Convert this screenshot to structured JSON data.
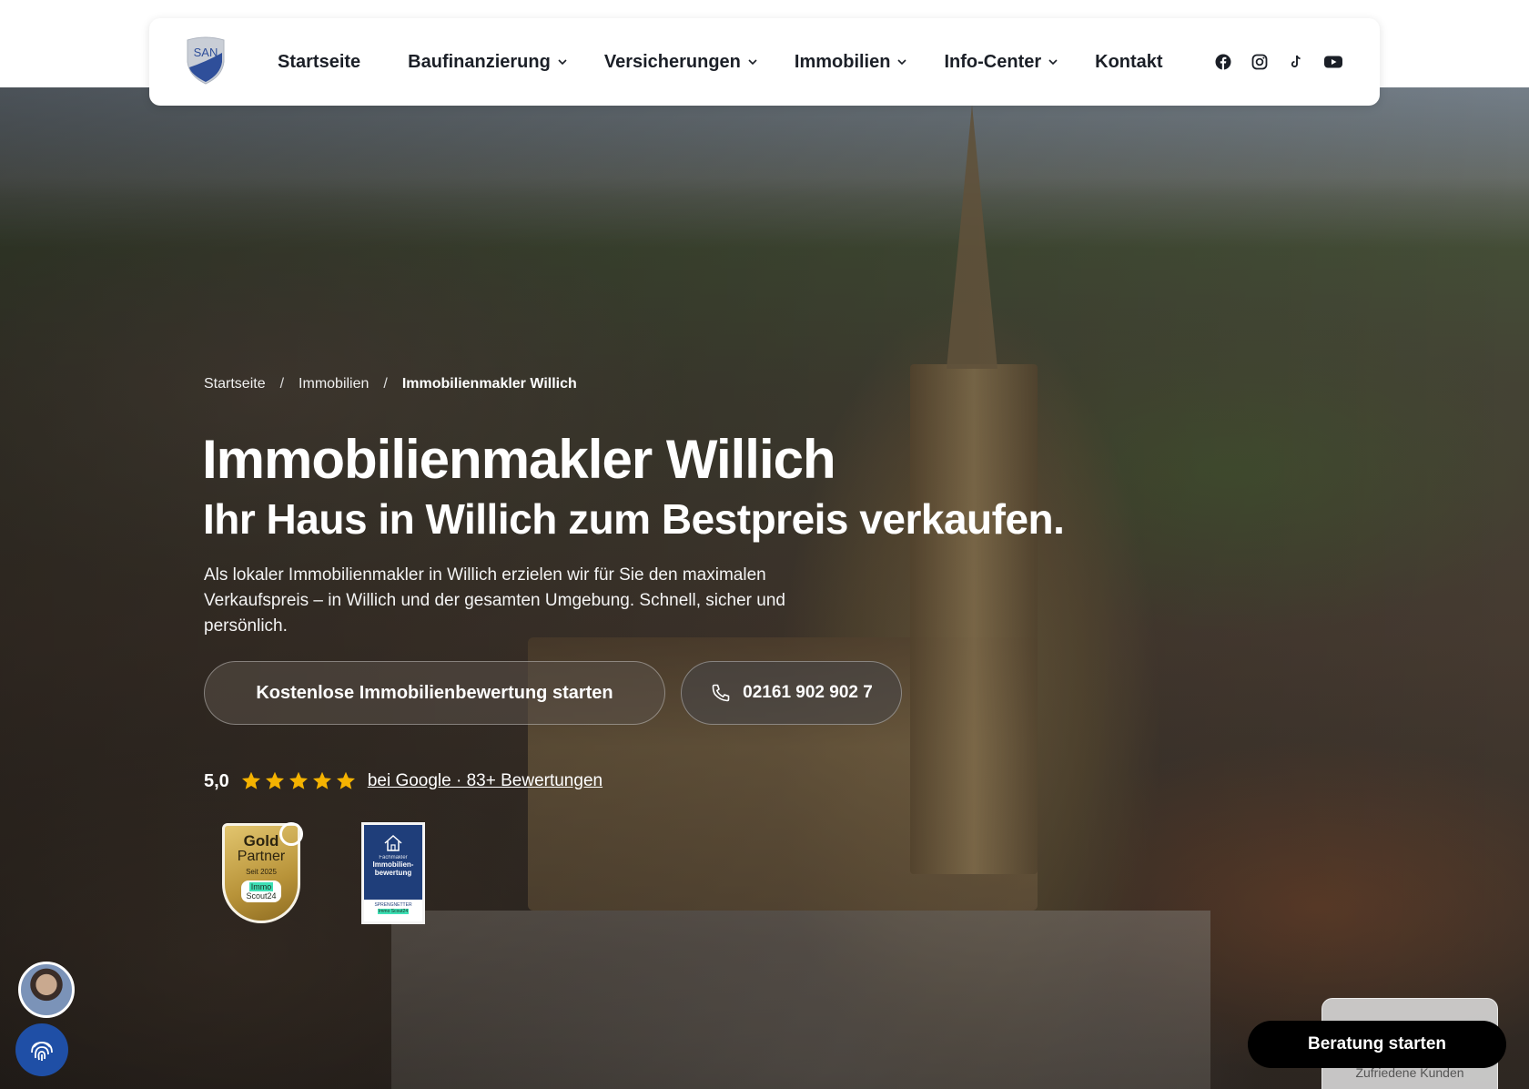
{
  "nav": {
    "logo_text": "SAN",
    "items": [
      {
        "label": "Startseite",
        "has_dropdown": false
      },
      {
        "label": "Baufinanzierung",
        "has_dropdown": true
      },
      {
        "label": "Versicherungen",
        "has_dropdown": true
      },
      {
        "label": "Immobilien",
        "has_dropdown": true
      },
      {
        "label": "Info-Center",
        "has_dropdown": true
      },
      {
        "label": "Kontakt",
        "has_dropdown": false
      }
    ],
    "socials": [
      "facebook-icon",
      "instagram-icon",
      "tiktok-icon",
      "youtube-icon"
    ]
  },
  "breadcrumb": {
    "items": [
      "Startseite",
      "Immobilien",
      "Immobilienmakler Willich"
    ],
    "separator": "/"
  },
  "hero": {
    "title": "Immobilienmakler Willich",
    "subtitle": "Ihr Haus in Willich zum Bestpreis verkaufen.",
    "intro": "Als lokaler Immobilienmakler in Willich erzielen wir für Sie den maximalen Verkaufspreis – in Willich und der gesamten Umgebung. Schnell, sicher und persönlich.",
    "cta_primary": "Kostenlose Immobilienbewertung starten",
    "cta_phone": "02161 902 902 7"
  },
  "rating": {
    "score": "5,0",
    "stars": 5,
    "link_text": "bei Google · 83+ Bewertungen",
    "star_color": "#F5B301"
  },
  "badges": {
    "gold": {
      "line1": "Gold",
      "line2": "Partner",
      "since": "Seit 2025",
      "brand_top": "Immo",
      "brand_bottom": "Scout24"
    },
    "blue": {
      "kicker": "Fachmakler",
      "title": "Immobilien-bewertung",
      "brand_line": "SPRENGNETTER",
      "brand": "Immo Scout24"
    }
  },
  "widgets": {
    "consult_button": "Beratung starten",
    "review_card_text": "Zufriedene Kunden"
  },
  "colors": {
    "nav_text": "#1B1F27",
    "consult_bg": "#000000",
    "fingerprint_bg": "#1F4FA6",
    "badge_blue": "#1F3E7A"
  }
}
